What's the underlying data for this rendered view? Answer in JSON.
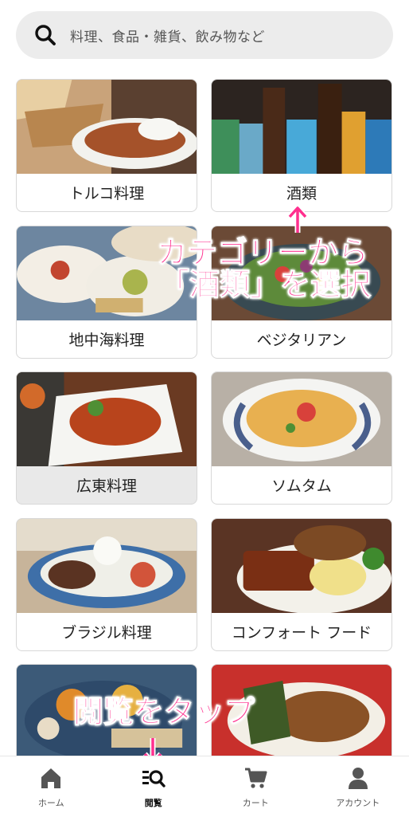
{
  "search": {
    "placeholder": "料理、食品・雑貨、飲み物など",
    "icon": "search-icon"
  },
  "categories": [
    {
      "label": "トルコ料理"
    },
    {
      "label": "酒類"
    },
    {
      "label": "地中海料理"
    },
    {
      "label": "ベジタリアン"
    },
    {
      "label": "広東料理",
      "selected": true
    },
    {
      "label": "ソムタム"
    },
    {
      "label": "ブラジル料理"
    },
    {
      "label": "コンフォート フード"
    }
  ],
  "annotations": {
    "category_line1": "カテゴリーから",
    "category_line2": "「酒類」を選択",
    "browse_tap": "閲覧をタップ",
    "color": "#ff2f8e"
  },
  "tabbar": {
    "home": "ホーム",
    "browse": "閲覧",
    "cart": "カート",
    "account": "アカウント"
  }
}
